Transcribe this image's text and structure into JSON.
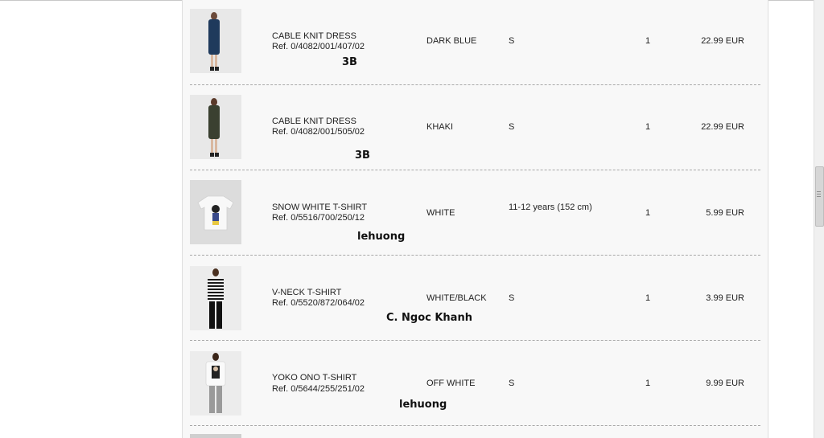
{
  "items": [
    {
      "name": "CABLE KNIT DRESS",
      "ref": "Ref. 0/4082/001/407/02",
      "color": "DARK BLUE",
      "size": "S",
      "qty": "1",
      "price": "22.99 EUR",
      "note": "3B",
      "img_color": "#1f3a5c"
    },
    {
      "name": "CABLE KNIT DRESS",
      "ref": "Ref. 0/4082/001/505/02",
      "color": "KHAKI",
      "size": "S",
      "qty": "1",
      "price": "22.99 EUR",
      "note": "3B",
      "img_color": "#3a4030"
    },
    {
      "name": "SNOW WHITE T-SHIRT",
      "ref": "Ref. 0/5516/700/250/12",
      "color": "WHITE",
      "size": "11-12 years (152 cm)",
      "qty": "1",
      "price": "5.99 EUR",
      "note": "lehuong",
      "img_color": "#f4f4f4"
    },
    {
      "name": "V-NECK T-SHIRT",
      "ref": "Ref. 0/5520/872/064/02",
      "color": "WHITE/BLACK",
      "size": "S",
      "qty": "1",
      "price": "3.99 EUR",
      "note": "C. Ngoc Khanh",
      "img_color": "#202020"
    },
    {
      "name": "YOKO ONO T-SHIRT",
      "ref": "Ref. 0/5644/255/251/02",
      "color": "OFF WHITE",
      "size": "S",
      "qty": "1",
      "price": "9.99 EUR",
      "note": "lehuong",
      "img_color": "#f2f2f2"
    }
  ]
}
